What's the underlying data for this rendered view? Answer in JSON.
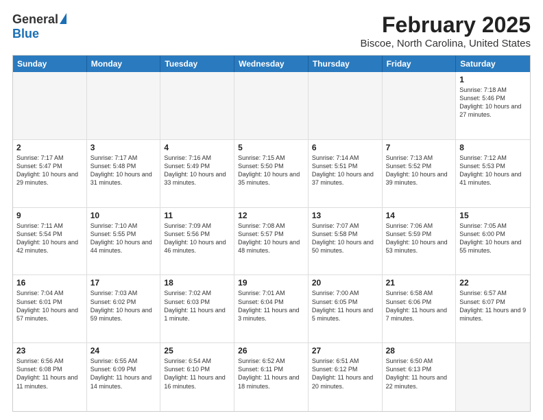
{
  "logo": {
    "general": "General",
    "blue": "Blue"
  },
  "title": "February 2025",
  "subtitle": "Biscoe, North Carolina, United States",
  "header": {
    "days": [
      "Sunday",
      "Monday",
      "Tuesday",
      "Wednesday",
      "Thursday",
      "Friday",
      "Saturday"
    ]
  },
  "weeks": [
    [
      {
        "num": "",
        "info": "",
        "empty": true
      },
      {
        "num": "",
        "info": "",
        "empty": true
      },
      {
        "num": "",
        "info": "",
        "empty": true
      },
      {
        "num": "",
        "info": "",
        "empty": true
      },
      {
        "num": "",
        "info": "",
        "empty": true
      },
      {
        "num": "",
        "info": "",
        "empty": true
      },
      {
        "num": "1",
        "info": "Sunrise: 7:18 AM\nSunset: 5:46 PM\nDaylight: 10 hours and 27 minutes.",
        "empty": false
      }
    ],
    [
      {
        "num": "2",
        "info": "Sunrise: 7:17 AM\nSunset: 5:47 PM\nDaylight: 10 hours and 29 minutes.",
        "empty": false
      },
      {
        "num": "3",
        "info": "Sunrise: 7:17 AM\nSunset: 5:48 PM\nDaylight: 10 hours and 31 minutes.",
        "empty": false
      },
      {
        "num": "4",
        "info": "Sunrise: 7:16 AM\nSunset: 5:49 PM\nDaylight: 10 hours and 33 minutes.",
        "empty": false
      },
      {
        "num": "5",
        "info": "Sunrise: 7:15 AM\nSunset: 5:50 PM\nDaylight: 10 hours and 35 minutes.",
        "empty": false
      },
      {
        "num": "6",
        "info": "Sunrise: 7:14 AM\nSunset: 5:51 PM\nDaylight: 10 hours and 37 minutes.",
        "empty": false
      },
      {
        "num": "7",
        "info": "Sunrise: 7:13 AM\nSunset: 5:52 PM\nDaylight: 10 hours and 39 minutes.",
        "empty": false
      },
      {
        "num": "8",
        "info": "Sunrise: 7:12 AM\nSunset: 5:53 PM\nDaylight: 10 hours and 41 minutes.",
        "empty": false
      }
    ],
    [
      {
        "num": "9",
        "info": "Sunrise: 7:11 AM\nSunset: 5:54 PM\nDaylight: 10 hours and 42 minutes.",
        "empty": false
      },
      {
        "num": "10",
        "info": "Sunrise: 7:10 AM\nSunset: 5:55 PM\nDaylight: 10 hours and 44 minutes.",
        "empty": false
      },
      {
        "num": "11",
        "info": "Sunrise: 7:09 AM\nSunset: 5:56 PM\nDaylight: 10 hours and 46 minutes.",
        "empty": false
      },
      {
        "num": "12",
        "info": "Sunrise: 7:08 AM\nSunset: 5:57 PM\nDaylight: 10 hours and 48 minutes.",
        "empty": false
      },
      {
        "num": "13",
        "info": "Sunrise: 7:07 AM\nSunset: 5:58 PM\nDaylight: 10 hours and 50 minutes.",
        "empty": false
      },
      {
        "num": "14",
        "info": "Sunrise: 7:06 AM\nSunset: 5:59 PM\nDaylight: 10 hours and 53 minutes.",
        "empty": false
      },
      {
        "num": "15",
        "info": "Sunrise: 7:05 AM\nSunset: 6:00 PM\nDaylight: 10 hours and 55 minutes.",
        "empty": false
      }
    ],
    [
      {
        "num": "16",
        "info": "Sunrise: 7:04 AM\nSunset: 6:01 PM\nDaylight: 10 hours and 57 minutes.",
        "empty": false
      },
      {
        "num": "17",
        "info": "Sunrise: 7:03 AM\nSunset: 6:02 PM\nDaylight: 10 hours and 59 minutes.",
        "empty": false
      },
      {
        "num": "18",
        "info": "Sunrise: 7:02 AM\nSunset: 6:03 PM\nDaylight: 11 hours and 1 minute.",
        "empty": false
      },
      {
        "num": "19",
        "info": "Sunrise: 7:01 AM\nSunset: 6:04 PM\nDaylight: 11 hours and 3 minutes.",
        "empty": false
      },
      {
        "num": "20",
        "info": "Sunrise: 7:00 AM\nSunset: 6:05 PM\nDaylight: 11 hours and 5 minutes.",
        "empty": false
      },
      {
        "num": "21",
        "info": "Sunrise: 6:58 AM\nSunset: 6:06 PM\nDaylight: 11 hours and 7 minutes.",
        "empty": false
      },
      {
        "num": "22",
        "info": "Sunrise: 6:57 AM\nSunset: 6:07 PM\nDaylight: 11 hours and 9 minutes.",
        "empty": false
      }
    ],
    [
      {
        "num": "23",
        "info": "Sunrise: 6:56 AM\nSunset: 6:08 PM\nDaylight: 11 hours and 11 minutes.",
        "empty": false
      },
      {
        "num": "24",
        "info": "Sunrise: 6:55 AM\nSunset: 6:09 PM\nDaylight: 11 hours and 14 minutes.",
        "empty": false
      },
      {
        "num": "25",
        "info": "Sunrise: 6:54 AM\nSunset: 6:10 PM\nDaylight: 11 hours and 16 minutes.",
        "empty": false
      },
      {
        "num": "26",
        "info": "Sunrise: 6:52 AM\nSunset: 6:11 PM\nDaylight: 11 hours and 18 minutes.",
        "empty": false
      },
      {
        "num": "27",
        "info": "Sunrise: 6:51 AM\nSunset: 6:12 PM\nDaylight: 11 hours and 20 minutes.",
        "empty": false
      },
      {
        "num": "28",
        "info": "Sunrise: 6:50 AM\nSunset: 6:13 PM\nDaylight: 11 hours and 22 minutes.",
        "empty": false
      },
      {
        "num": "",
        "info": "",
        "empty": true
      }
    ]
  ]
}
